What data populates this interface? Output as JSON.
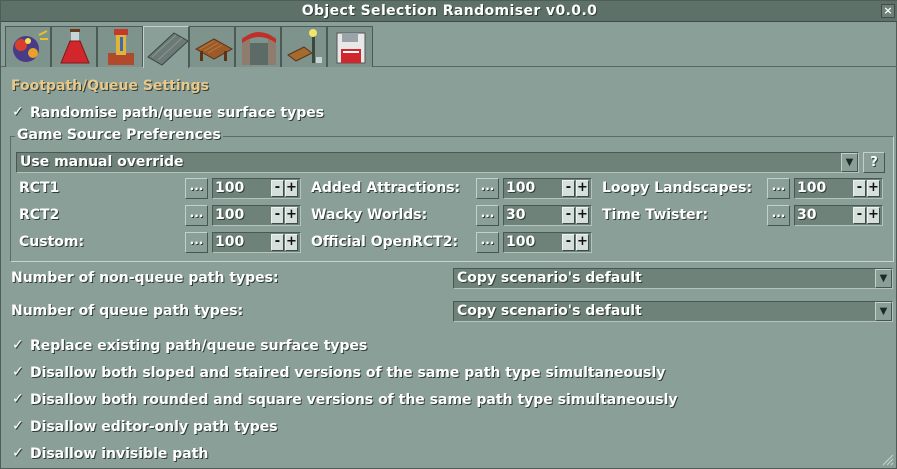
{
  "window": {
    "title": "Object Selection Randomiser v0.0.0",
    "close_glyph": "×"
  },
  "tabs": [
    {
      "name": "scenery-tab",
      "icon": "fireworks-icon"
    },
    {
      "name": "research-tab",
      "icon": "flask-icon"
    },
    {
      "name": "rides-tab",
      "icon": "ride-tower-icon"
    },
    {
      "name": "footpath-tab",
      "icon": "footpath-icon",
      "active": true
    },
    {
      "name": "benches-tab",
      "icon": "bench-icon"
    },
    {
      "name": "entrance-tab",
      "icon": "park-entrance-icon"
    },
    {
      "name": "path-items-tab",
      "icon": "lamp-bench-icon"
    },
    {
      "name": "save-tab",
      "icon": "floppy-disk-icon"
    }
  ],
  "section_heading": "Footpath/Queue Settings",
  "randomise_surface": {
    "label": "Randomise path/queue surface types",
    "checked": true
  },
  "game_source": {
    "title": "Game Source Preferences",
    "mode": "Use manual override",
    "help_label": "?",
    "dots_label": "...",
    "minus_label": "-",
    "plus_label": "+",
    "sources": [
      {
        "label": "RCT1",
        "value": "100"
      },
      {
        "label": "Added Attractions:",
        "value": "100"
      },
      {
        "label": "Loopy Landscapes:",
        "value": "100"
      },
      {
        "label": "RCT2",
        "value": "100"
      },
      {
        "label": "Wacky Worlds:",
        "value": "30"
      },
      {
        "label": "Time Twister:",
        "value": "30"
      },
      {
        "label": "Custom:",
        "value": "100"
      },
      {
        "label": "Official OpenRCT2:",
        "value": "100"
      }
    ]
  },
  "non_queue_count": {
    "label": "Number of non-queue path types:",
    "value": "Copy scenario's default"
  },
  "queue_count": {
    "label": "Number of queue path types:",
    "value": "Copy scenario's default"
  },
  "options": [
    {
      "label": "Replace existing path/queue surface types",
      "checked": true
    },
    {
      "label": "Disallow both sloped and staired versions of the same path type simultaneously",
      "checked": true
    },
    {
      "label": "Disallow both rounded and square versions of the same path type simultaneously",
      "checked": true
    },
    {
      "label": "Disallow editor-only path types",
      "checked": true
    },
    {
      "label": "Disallow invisible path",
      "checked": true
    }
  ],
  "colors": {
    "window_bg": "#8a9f98",
    "titlebar": "#5e7169",
    "heading": "#e9c98a",
    "text": "#ffffff"
  },
  "dropdown_arrow": "▼"
}
